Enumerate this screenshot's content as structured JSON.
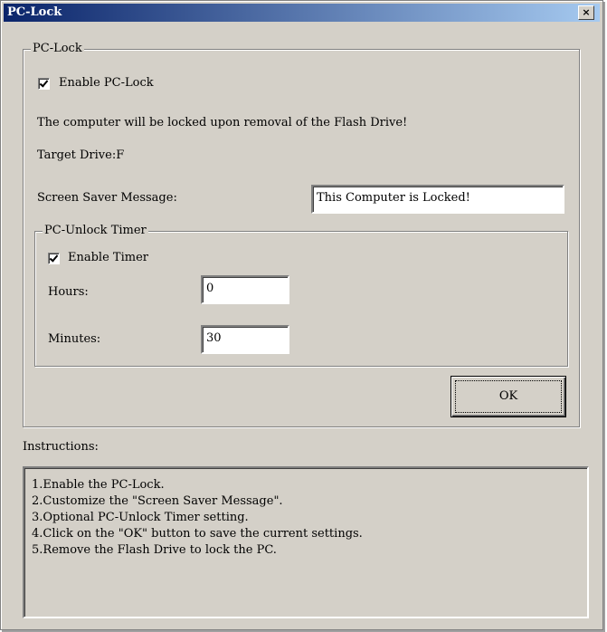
{
  "window": {
    "title": "PC-Lock",
    "close_glyph": "×"
  },
  "pclock_group": {
    "legend": "PC-Lock",
    "enable_label": "Enable PC-Lock",
    "enable_checked": true,
    "info_text": "The computer will be locked upon removal of the Flash Drive!",
    "target_drive": "Target Drive:F",
    "screen_saver_label": "Screen Saver Message:",
    "screen_saver_value": "This Computer is Locked!"
  },
  "timer_group": {
    "legend": "PC-Unlock Timer",
    "enable_label": "Enable Timer",
    "enable_checked": true,
    "hours_label": "Hours:",
    "hours_value": "0",
    "minutes_label": "Minutes:",
    "minutes_value": "30"
  },
  "ok_button": {
    "label": "OK"
  },
  "instructions": {
    "label": "Instructions:",
    "lines": [
      "1.Enable the PC-Lock.",
      "2.Customize the \"Screen Saver Message\".",
      "3.Optional PC-Unlock Timer setting.",
      "4.Click on the \"OK\" button to save the current settings.",
      "5.Remove the Flash Drive to lock the PC."
    ]
  }
}
